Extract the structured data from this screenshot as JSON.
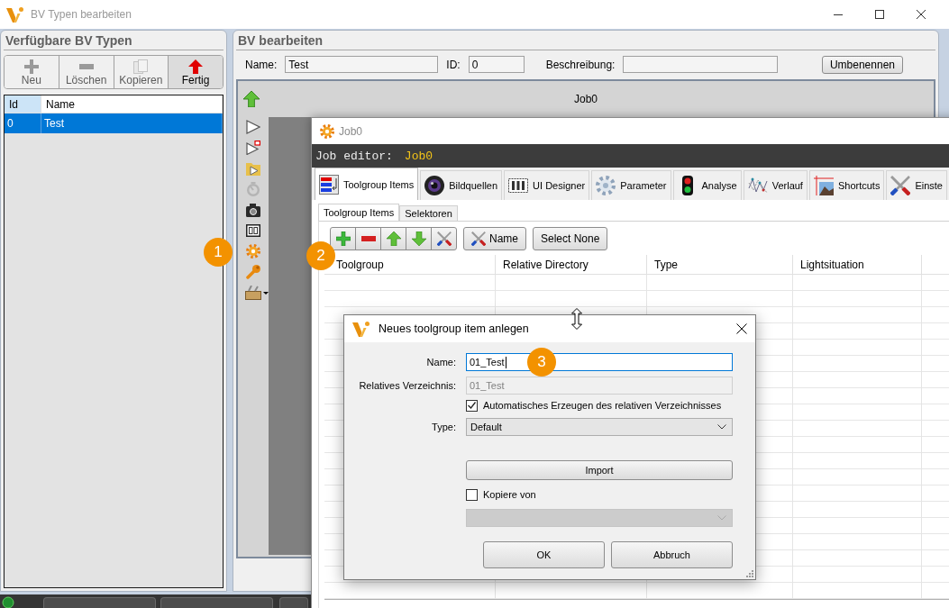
{
  "window": {
    "title": "BV Typen bearbeiten"
  },
  "types_panel": {
    "title": "Verfügbare BV Typen",
    "toolbar": [
      {
        "label": "Neu",
        "kind": "add",
        "disabled": true,
        "highlighted": false
      },
      {
        "label": "Löschen",
        "kind": "delete",
        "disabled": true,
        "highlighted": false
      },
      {
        "label": "Kopieren",
        "kind": "copy",
        "disabled": true,
        "highlighted": false
      },
      {
        "label": "Fertig",
        "kind": "done",
        "disabled": false,
        "highlighted": true
      }
    ],
    "list": {
      "columns": [
        {
          "label": "Id",
          "sorted": true
        },
        {
          "label": "Name",
          "sorted": false
        }
      ],
      "rows": [
        {
          "cells": [
            "0",
            "Test"
          ],
          "selected": true
        }
      ]
    }
  },
  "edit_panel": {
    "title": "BV bearbeiten",
    "fields": [
      {
        "label": "Name:",
        "value": "Test"
      },
      {
        "label": "ID:",
        "value": "0"
      },
      {
        "label": "Beschreibung:"
      }
    ],
    "rename_button": "Umbenennen",
    "job_title": "Job0"
  },
  "job_window": {
    "title": "Job0",
    "editor_label": "Job editor:",
    "editor_job": "Job0",
    "tabs": [
      {
        "label": "Toolgroup Items",
        "selected": true
      },
      {
        "label": "Bildquellen",
        "selected": false
      },
      {
        "label": "UI Designer",
        "selected": false
      },
      {
        "label": "Parameter",
        "selected": false
      },
      {
        "label": "Analyse",
        "selected": false
      },
      {
        "label": "Verlauf",
        "selected": false
      },
      {
        "label": "Shortcuts",
        "selected": false
      },
      {
        "label": "Einste",
        "selected": false
      }
    ],
    "subtabs": [
      {
        "label": "Toolgroup Items",
        "selected": true
      },
      {
        "label": "Selektoren",
        "selected": false
      }
    ],
    "toolbar_buttons": [
      {
        "label": "Name",
        "kind": "tools"
      },
      {
        "label": "Select None",
        "kind": "plain"
      }
    ],
    "table": {
      "columns": [
        "Toolgroup",
        "Relative Directory",
        "Type",
        "Lightsituation"
      ]
    }
  },
  "dialog": {
    "title": "Neues toolgroup item anlegen",
    "name": {
      "label": "Name:",
      "value": "01_Test",
      "focused": true
    },
    "directory": {
      "label": "Relatives Verzeichnis:",
      "value": "01_Test",
      "disabled": true
    },
    "auto_directory": {
      "label": "Automatisches Erzeugen des relativen Verzeichnisses",
      "checked": true
    },
    "type": {
      "label": "Type:",
      "value": "Default"
    },
    "import_button": "Import",
    "copy_from": {
      "label": "Kopiere von",
      "checked": false
    },
    "copy_source": {
      "disabled": true
    },
    "buttons": [
      "OK",
      "Abbruch"
    ]
  },
  "callouts": [
    "1",
    "2",
    "3"
  ]
}
